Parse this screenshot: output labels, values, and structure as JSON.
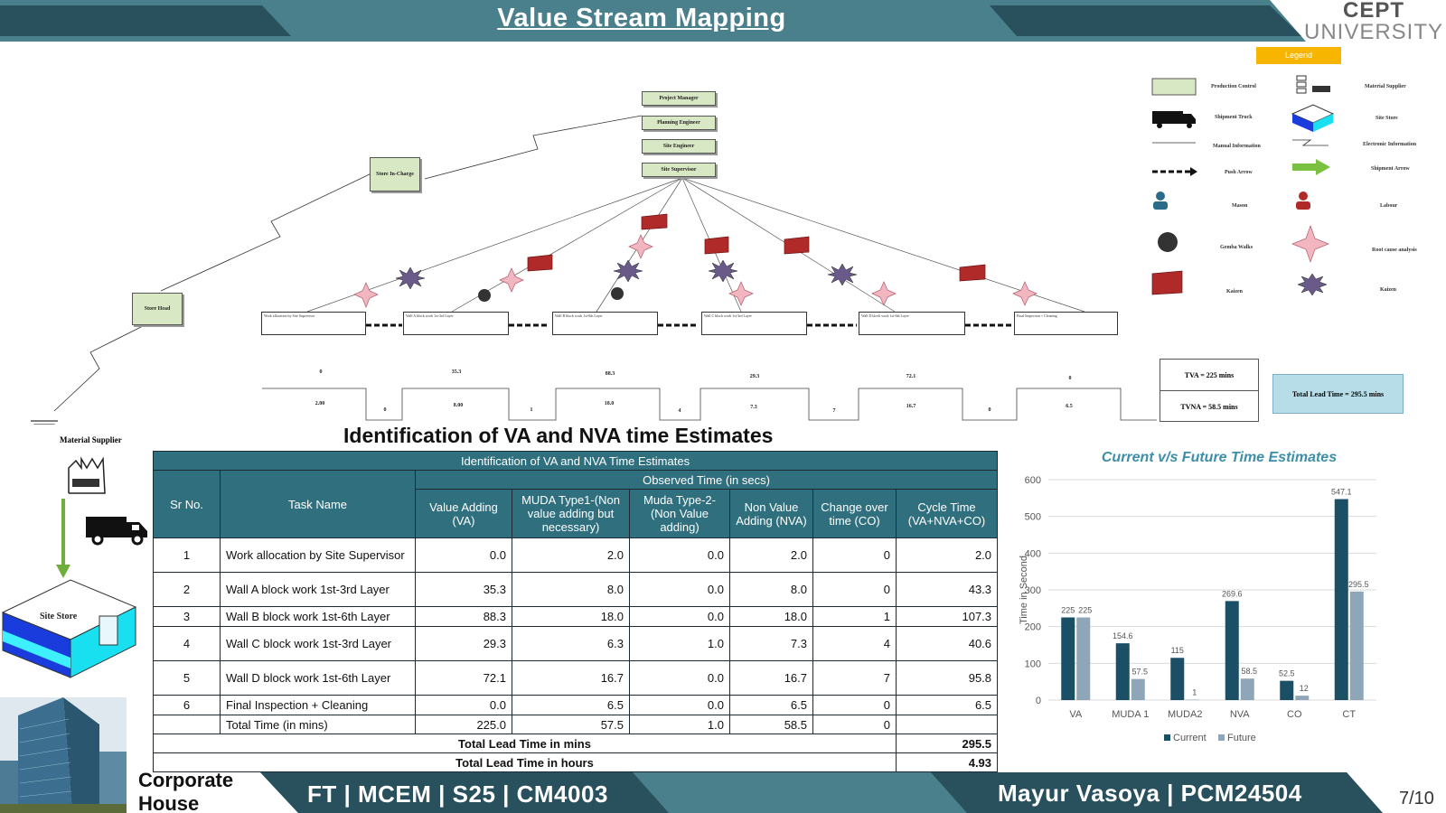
{
  "header": {
    "title": "Value Stream Mapping",
    "logo_line1": "CEPT",
    "logo_line2": "UNIVERSITY",
    "bar_color": "#2f6f7e"
  },
  "legend": {
    "title": "Legend",
    "items": [
      "Production Control",
      "Material Supplier",
      "Shipment Truck",
      "Site Store",
      "Manual Information",
      "Electronic Information",
      "Push Arrow",
      "Shipment Arrow",
      "Mason",
      "Labour",
      "Gemba Walks",
      "Root cause analysis",
      "Kaizen",
      "Kaizen"
    ]
  },
  "vsm": {
    "chain": [
      "Project Manager",
      "Planning Engineer",
      "Site Engineer",
      "Site Supervisor"
    ],
    "store_in_charge": "Store In-Charge",
    "store_head": "Store Head",
    "material_supplier": "Material Supplier",
    "site_store": "Site Store",
    "processes": [
      "Work allocation by Site Supervisor",
      "Wall A block work 1st-3rd Layer",
      "Wall B block work 1st-6th Layer",
      "Wall C block work 1st-3rd Layer",
      "Wall D block work 1st-6th Layer",
      "Final Inspection + Cleaning"
    ],
    "timeline_top": [
      "0",
      "35.3",
      "88.3",
      "29.3",
      "72.1",
      "0"
    ],
    "timeline_bottom": [
      "2.00",
      "0",
      "8.00",
      "1",
      "18.0",
      "4",
      "7.3",
      "7",
      "16.7",
      "0",
      "6.5"
    ],
    "tva": "TVA = 225 mins",
    "tnva": "TVNA = 58.5 mins",
    "total_lead": "Total Lead Time = 295.5 mins"
  },
  "section_heading": "Identification of VA and NVA time Estimates",
  "table": {
    "title": "Identification of VA and NVA Time Estimates",
    "observed_header": "Observed Time (in secs)",
    "headers": {
      "sr": "Sr No.",
      "task": "Task Name",
      "va": "Value Adding (VA)",
      "muda1": "MUDA Type1-(Non value adding but necessary)",
      "muda2": "Muda Type-2- (Non Value adding)",
      "nva": "Non Value Adding (NVA)",
      "co": "Change over time (CO)",
      "ct": "Cycle Time (VA+NVA+CO)"
    },
    "rows": [
      {
        "sr": "1",
        "task": "Work allocation by Site Supervisor",
        "va": "0.0",
        "muda1": "2.0",
        "muda2": "0.0",
        "nva": "2.0",
        "co": "0",
        "ct": "2.0"
      },
      {
        "sr": "2",
        "task": "Wall A block work 1st-3rd Layer",
        "va": "35.3",
        "muda1": "8.0",
        "muda2": "0.0",
        "nva": "8.0",
        "co": "0",
        "ct": "43.3"
      },
      {
        "sr": "3",
        "task": "Wall B block work 1st-6th  Layer",
        "va": "88.3",
        "muda1": "18.0",
        "muda2": "0.0",
        "nva": "18.0",
        "co": "1",
        "ct": "107.3"
      },
      {
        "sr": "4",
        "task": "Wall C block work 1st-3rd Layer",
        "va": "29.3",
        "muda1": "6.3",
        "muda2": "1.0",
        "nva": "7.3",
        "co": "4",
        "ct": "40.6"
      },
      {
        "sr": "5",
        "task": "Wall D block work 1st-6th Layer",
        "va": "72.1",
        "muda1": "16.7",
        "muda2": "0.0",
        "nva": "16.7",
        "co": "7",
        "ct": "95.8"
      },
      {
        "sr": "6",
        "task": "Final Inspection + Cleaning",
        "va": "0.0",
        "muda1": "6.5",
        "muda2": "0.0",
        "nva": "6.5",
        "co": "0",
        "ct": "6.5"
      }
    ],
    "total_row": {
      "label": "Total Time (in mins)",
      "va": "225.0",
      "muda1": "57.5",
      "muda2": "1.0",
      "nva": "58.5",
      "co": "0",
      "ct": ""
    },
    "lead_mins_label": "Total Lead Time in mins",
    "lead_mins_value": "295.5",
    "lead_hours_label": "Total Lead Time in hours",
    "lead_hours_value": "4.93"
  },
  "chart_data": {
    "type": "bar",
    "title": "Current v/s Future Time Estimates",
    "categories": [
      "VA",
      "MUDA 1",
      "MUDA2",
      "NVA",
      "CO",
      "CT"
    ],
    "series": [
      {
        "name": "Current",
        "values": [
          225,
          154.6,
          115,
          269.6,
          52.5,
          547.1
        ],
        "color": "#1b4f66"
      },
      {
        "name": "Future",
        "values": [
          225,
          57.5,
          1,
          58.5,
          12,
          295.5
        ],
        "color": "#8fa6b8"
      }
    ],
    "ylabel": "Time in Second",
    "ylim": [
      0,
      600
    ],
    "yticks": [
      0,
      100,
      200,
      300,
      400,
      500,
      600
    ],
    "grid": true,
    "legend_position": "bottom"
  },
  "footer": {
    "corporate_line1": "Corporate",
    "corporate_line2": "House",
    "left_text": "FT | MCEM | S25 | CM4003",
    "right_text": "Mayur Vasoya | PCM24504",
    "page": "7/10"
  }
}
